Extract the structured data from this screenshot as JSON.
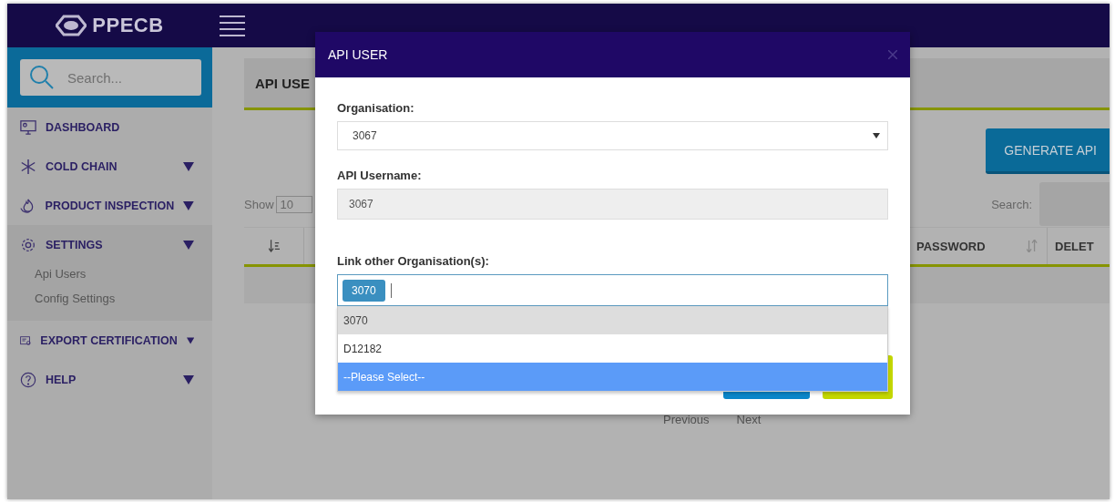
{
  "header": {
    "logo": "PPECB"
  },
  "sidebar": {
    "search": {
      "placeholder": "Search..."
    },
    "items": [
      {
        "label": "DASHBOARD",
        "has_submenu": false,
        "expanded": false
      },
      {
        "label": "COLD CHAIN",
        "has_submenu": true,
        "expanded": false
      },
      {
        "label": "PRODUCT INSPECTION",
        "has_submenu": true,
        "expanded": false
      },
      {
        "label": "SETTINGS",
        "has_submenu": true,
        "expanded": true,
        "children": [
          {
            "label": "Api Users"
          },
          {
            "label": "Config Settings"
          }
        ]
      },
      {
        "label": "EXPORT CERTIFICATION",
        "has_submenu": true,
        "expanded": false
      },
      {
        "label": "HELP",
        "has_submenu": true,
        "expanded": false
      }
    ]
  },
  "page": {
    "tab": "API USE",
    "generate_button": "GENERATE API",
    "show_label": "Show",
    "page_size": "10",
    "search_label": "Search:",
    "columns": [
      {
        "label": "PASSWORD"
      },
      {
        "label": "DELET"
      }
    ],
    "pagination": [
      "Previous",
      "Next"
    ]
  },
  "modal": {
    "title": "API USER",
    "fields": [
      {
        "kind": "select",
        "label": "Organisation:",
        "value": "3067"
      },
      {
        "kind": "readonly",
        "label": "API Username:",
        "value": "3067"
      },
      {
        "kind": "tags",
        "label": "Link other Organisation(s):",
        "tags": [
          "3070"
        ],
        "options": [
          {
            "label": "3070",
            "chosen": true,
            "selected": false
          },
          {
            "label": "D12182",
            "chosen": false,
            "selected": false
          },
          {
            "label": "--Please Select--",
            "chosen": false,
            "selected": true
          }
        ]
      }
    ]
  }
}
